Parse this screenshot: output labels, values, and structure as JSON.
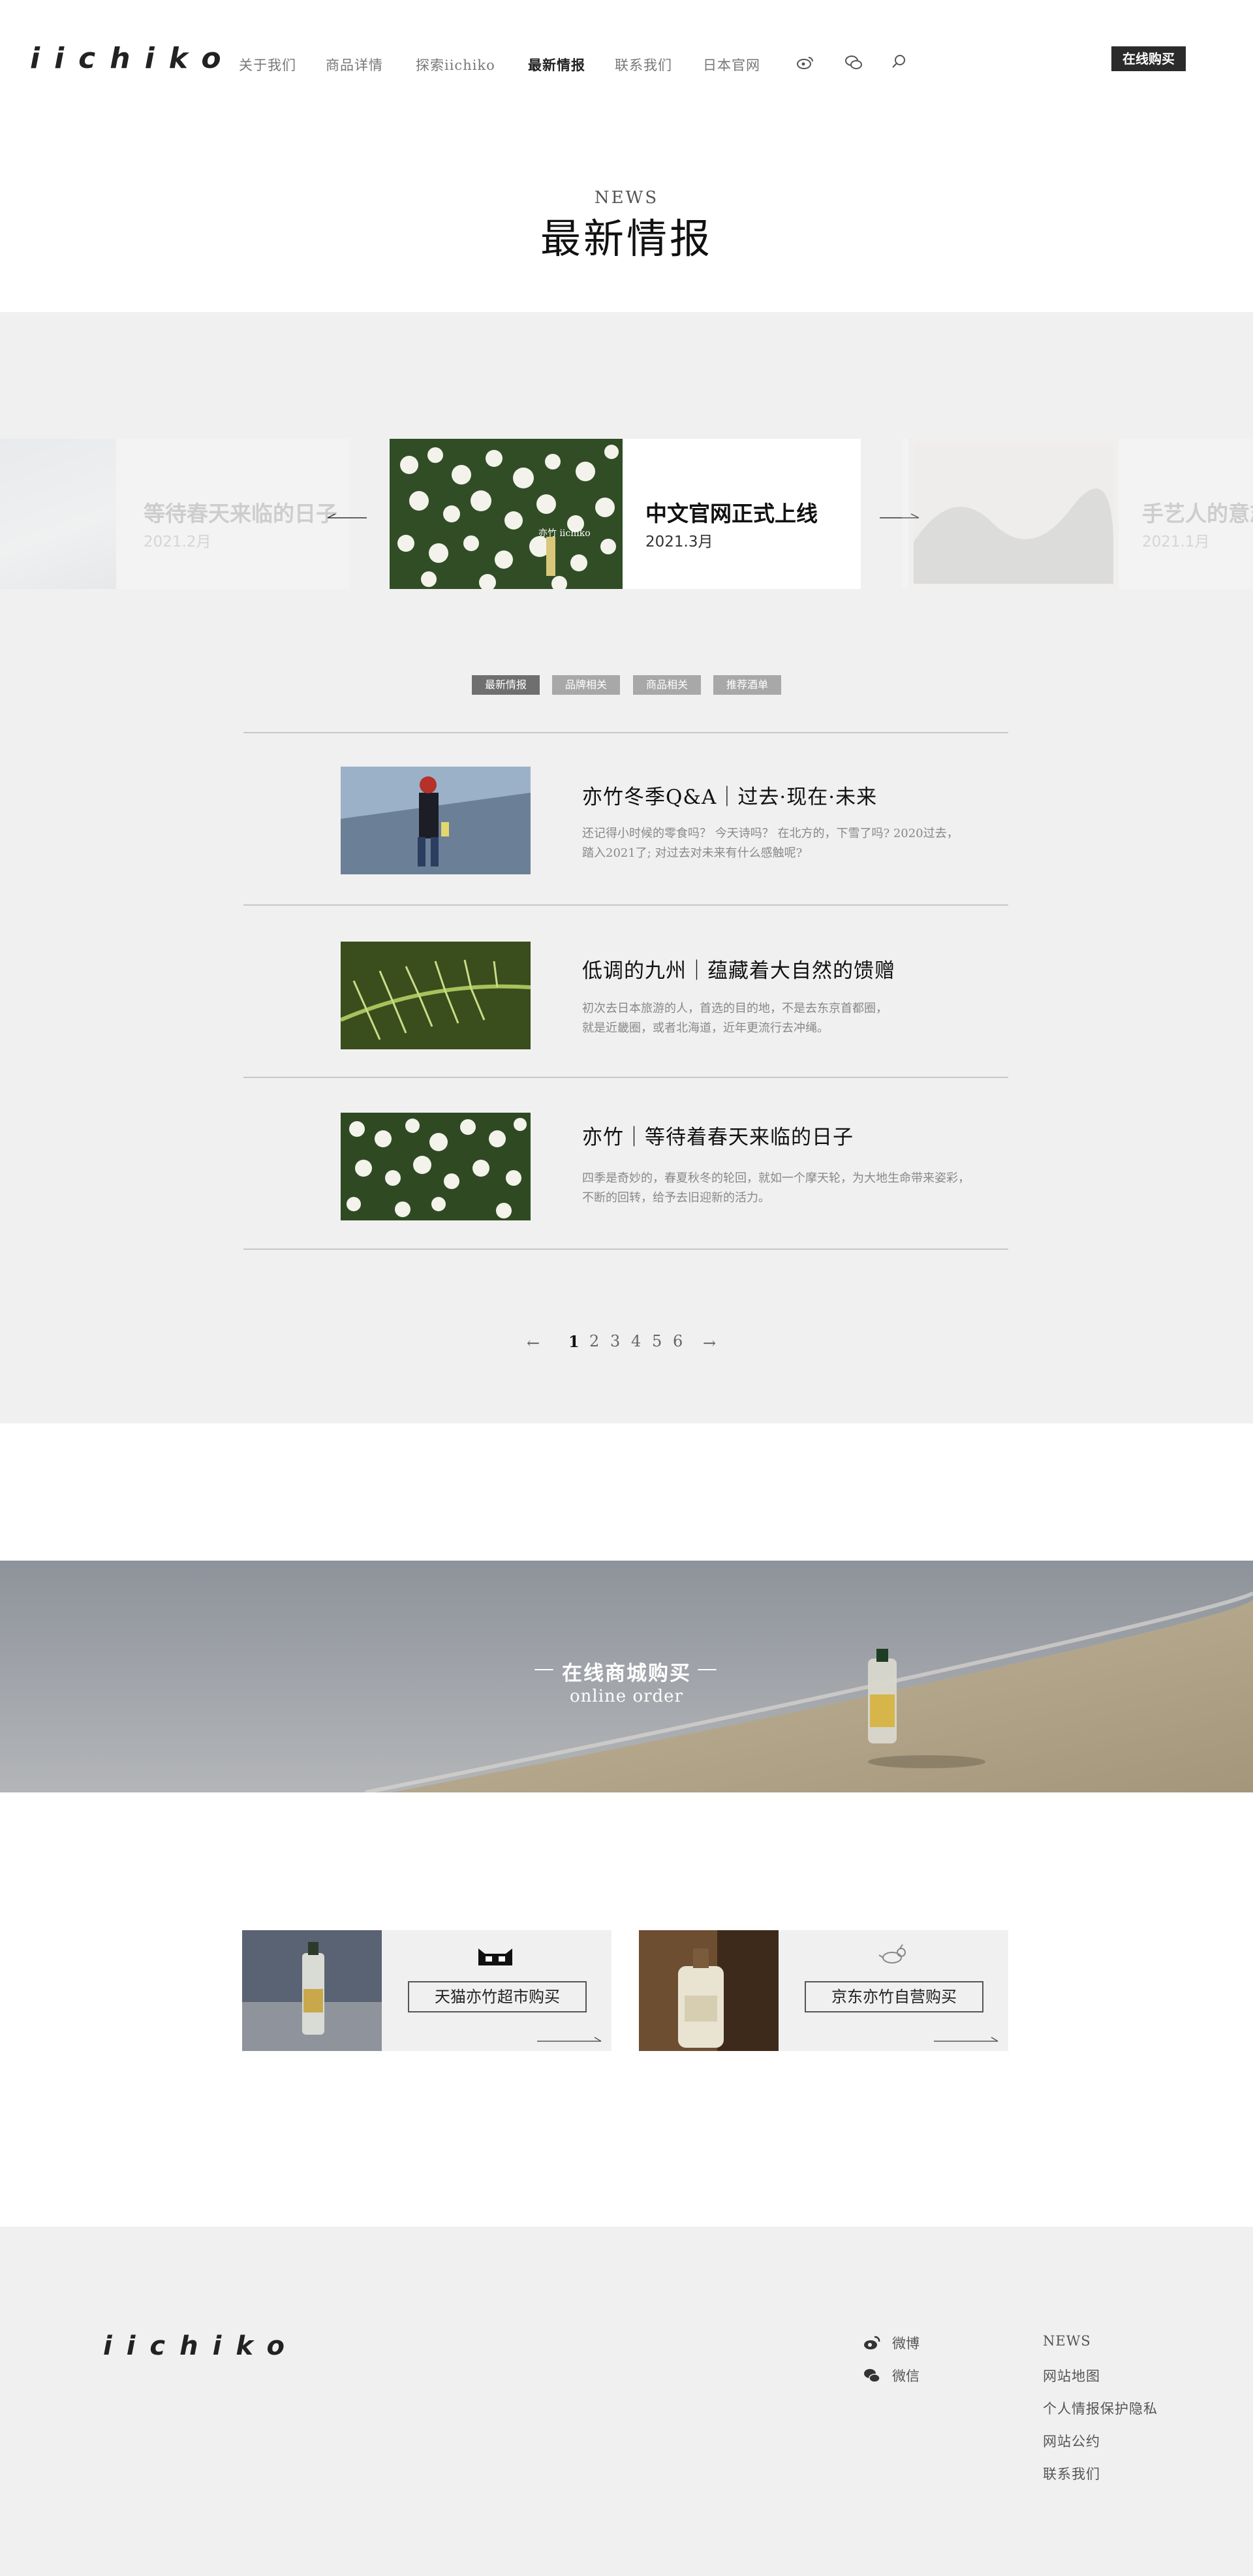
{
  "header": {
    "logo": "iichiko",
    "nav": [
      "关于我们",
      "商品详情",
      "探索iichiko",
      "最新情报",
      "联系我们",
      "日本官网"
    ],
    "active_nav": "最新情报",
    "buy_label": "在线购买",
    "icons": [
      "weibo-icon",
      "wechat-icon",
      "search-icon"
    ]
  },
  "page_title": {
    "en": "NEWS",
    "zh": "最新情报"
  },
  "carousel": {
    "prev": {
      "title": "等待春天来临的日子",
      "date": "2021.2月"
    },
    "current": {
      "title": "中文官网正式上线",
      "date": "2021.3月",
      "image_caption": "亦竹 iichiko"
    },
    "next": {
      "title": "手艺人的意志",
      "date": "2021.1月"
    }
  },
  "tags": [
    "最新情报",
    "品牌相关",
    "商品相关",
    "推荐酒单"
  ],
  "articles": [
    {
      "title": "亦竹冬季Q&A｜过去·现在·未来",
      "desc1": "还记得小时候的零食吗？ 今天诗吗？ 在北方的，下雪了吗? 2020过去，",
      "desc2": "踏入2021了; 对过去对未来有什么感触呢?"
    },
    {
      "title": "低调的九州｜蕴藏着大自然的馈赠",
      "desc1": "初次去日本旅游的人，首选的目的地，不是去东京首都圈，",
      "desc2": "就是近畿圈，或者北海道，近年更流行去冲绳。"
    },
    {
      "title": "亦竹｜等待着春天来临的日子",
      "desc1": "四季是奇妙的，春夏秋冬的轮回，就如一个摩天轮，为大地生命带来姿彩，",
      "desc2": "不断的回转，给予去旧迎新的活力。"
    }
  ],
  "pagination": {
    "pages": [
      "1",
      "2",
      "3",
      "4",
      "5",
      "6"
    ],
    "current": "1",
    "prev": "←",
    "next": "→"
  },
  "banner": {
    "zh": "在线商城购买",
    "en": "online order",
    "dash_left": "—",
    "dash_right": "—"
  },
  "shops": [
    {
      "label": "天猫亦竹超市购买",
      "icon": "tmall-icon"
    },
    {
      "label": "京东亦竹自营购买",
      "icon": "jd-dog-icon"
    }
  ],
  "footer": {
    "logo": "iichiko",
    "social": [
      {
        "label": "微博",
        "icon": "weibo-icon"
      },
      {
        "label": "微信",
        "icon": "wechat-icon"
      }
    ],
    "links": [
      "NEWS",
      "网站地图",
      "个人情报保护隐私",
      "网站公约",
      "联系我们"
    ]
  },
  "colors": {
    "dark": "#2b2b2b",
    "section_bg": "#f0f0f0",
    "tag_active": "#6f6f6f",
    "tag": "#a8a8a8"
  }
}
